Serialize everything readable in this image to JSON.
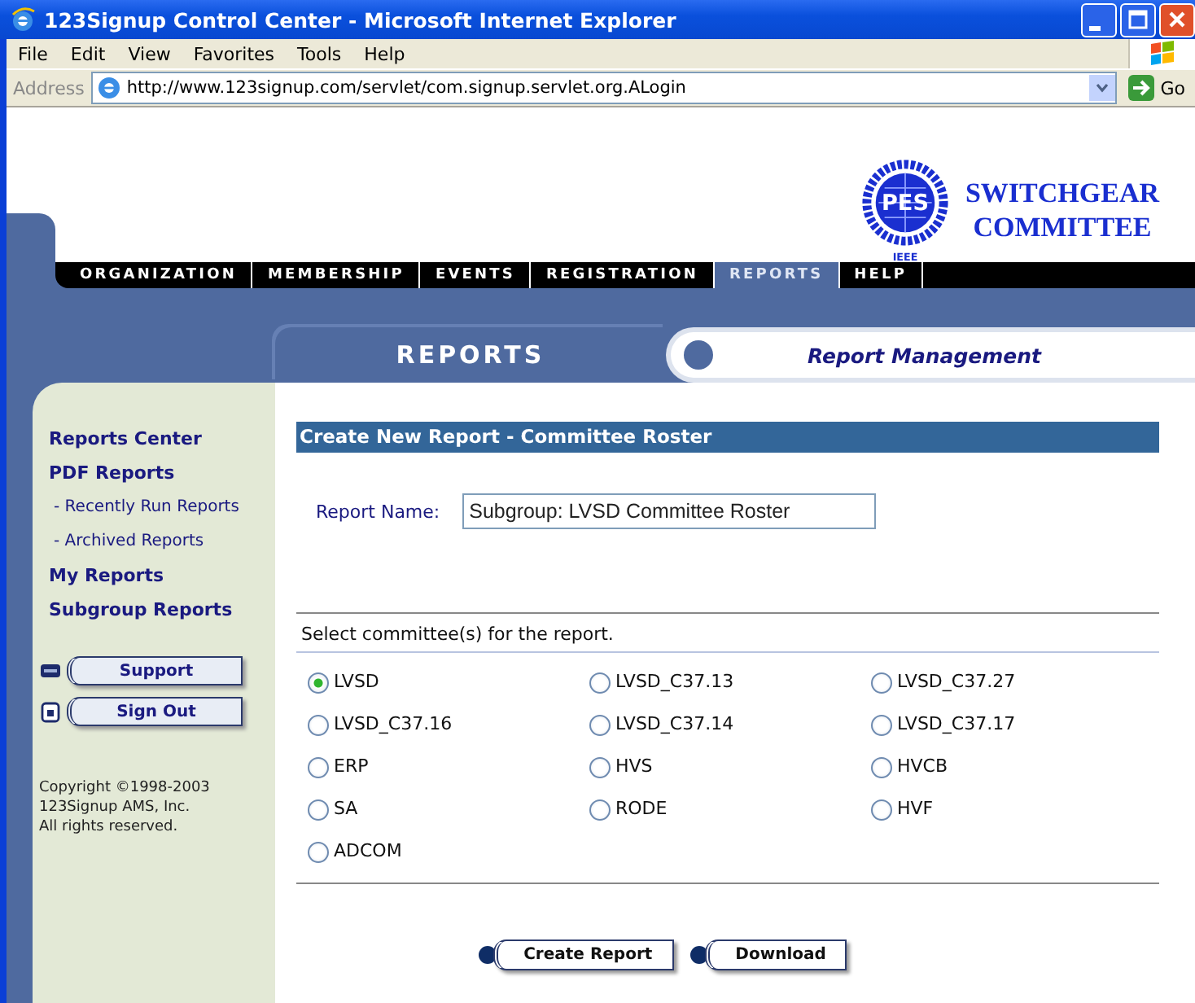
{
  "window": {
    "title": "123Signup Control Center - Microsoft Internet Explorer"
  },
  "menu": [
    "File",
    "Edit",
    "View",
    "Favorites",
    "Tools",
    "Help"
  ],
  "address_bar": {
    "label": "Address",
    "url": "http://www.123signup.com/servlet/com.signup.servlet.org.ALogin",
    "go": "Go"
  },
  "logo": {
    "emblem": "PES",
    "emblem_sub": "IEEE",
    "title_lines": [
      "SWITCHGEAR",
      "COMMITTEE"
    ]
  },
  "nav": [
    {
      "label": "ORGANIZATION",
      "selected": false
    },
    {
      "label": "MEMBERSHIP",
      "selected": false
    },
    {
      "label": "EVENTS",
      "selected": false
    },
    {
      "label": "REGISTRATION",
      "selected": false
    },
    {
      "label": "REPORTS",
      "selected": true
    },
    {
      "label": "HELP",
      "selected": false
    }
  ],
  "section_tab": {
    "label": "REPORTS",
    "subtitle": "Report Management"
  },
  "sidebar": {
    "items": [
      {
        "label": "Reports Center",
        "kind": "link"
      },
      {
        "label": "PDF Reports",
        "kind": "link"
      },
      {
        "label": "- Recently Run Reports",
        "kind": "sublink"
      },
      {
        "label": "- Archived Reports",
        "kind": "sublink"
      },
      {
        "label": "My Reports",
        "kind": "link"
      },
      {
        "label": "Subgroup Reports",
        "kind": "link"
      }
    ],
    "buttons": [
      {
        "label": "Support",
        "kind": "phone"
      },
      {
        "label": "Sign Out",
        "kind": "lock"
      }
    ],
    "copyright": [
      "Copyright ©1998-2003",
      "123Signup AMS, Inc.",
      "All rights reserved."
    ]
  },
  "form": {
    "heading": "Create New Report - Committee Roster",
    "report_name": {
      "label": "Report Name:",
      "value": "Subgroup: LVSD Committee Roster"
    },
    "prompt": "Select committee(s) for the report.",
    "committees": [
      {
        "label": "LVSD",
        "selected": true
      },
      {
        "label": "LVSD_C37.13",
        "selected": false
      },
      {
        "label": "LVSD_C37.27",
        "selected": false
      },
      {
        "label": "LVSD_C37.16",
        "selected": false
      },
      {
        "label": "LVSD_C37.14",
        "selected": false
      },
      {
        "label": "LVSD_C37.17",
        "selected": false
      },
      {
        "label": "ERP",
        "selected": false
      },
      {
        "label": "HVS",
        "selected": false
      },
      {
        "label": "HVCB",
        "selected": false
      },
      {
        "label": "SA",
        "selected": false
      },
      {
        "label": "RODE",
        "selected": false
      },
      {
        "label": "HVF",
        "selected": false
      },
      {
        "label": "ADCOM",
        "selected": false
      }
    ],
    "buttons": [
      "Create Report",
      "Download"
    ]
  }
}
